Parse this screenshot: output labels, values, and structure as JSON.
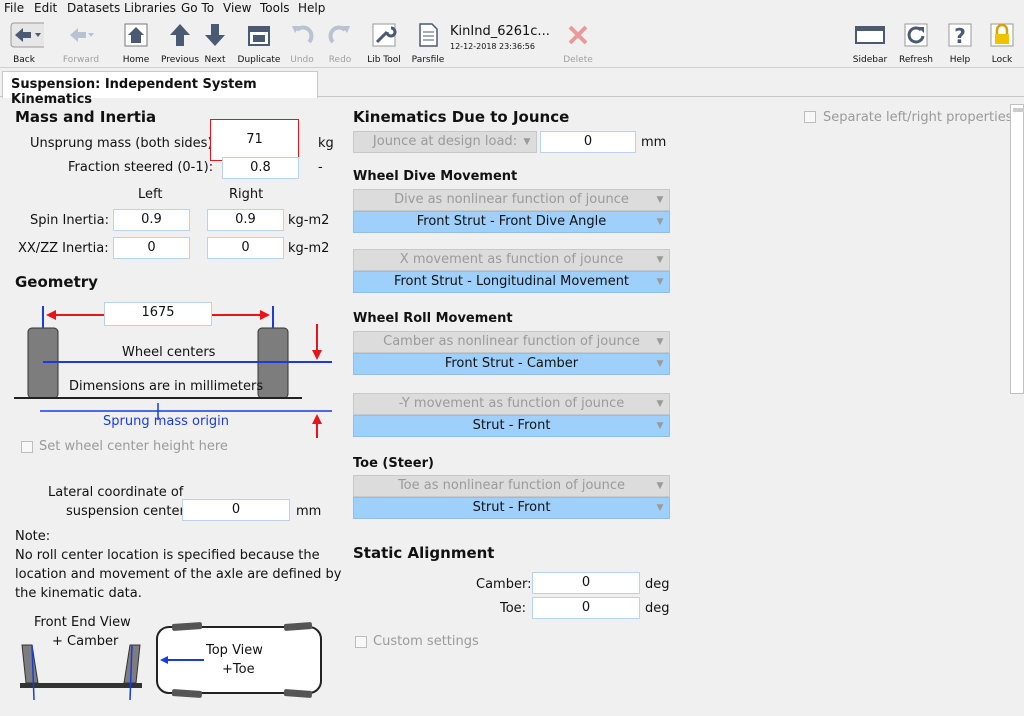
{
  "menu": [
    "File",
    "Edit",
    "Datasets",
    "Libraries",
    "Go To",
    "View",
    "Tools",
    "Help"
  ],
  "toolbar": {
    "back": "Back",
    "forward": "Forward",
    "home": "Home",
    "previous": "Previous",
    "next": "Next",
    "duplicate": "Duplicate",
    "undo": "Undo",
    "redo": "Redo",
    "libtool": "Lib Tool",
    "parsfile": "Parsfile",
    "dataset_title": "KinInd_6261c...",
    "dataset_date": "12-12-2018 23:36:56",
    "delete": "Delete",
    "sidebar": "Sidebar",
    "refresh": "Refresh",
    "help": "Help",
    "lock": "Lock"
  },
  "tab_title": "Suspension: Independent System Kinematics",
  "mass": {
    "heading": "Mass and Inertia",
    "unsprung_label": "Unsprung mass (both sides):",
    "unsprung_value": "71",
    "unsprung_unit": "kg",
    "fraction_label": "Fraction steered (0-1):",
    "fraction_value": "0.8",
    "fraction_unit": "-",
    "left": "Left",
    "right": "Right",
    "spin_label": "Spin Inertia:",
    "spin_left": "0.9",
    "spin_right": "0.9",
    "spin_unit": "kg-m2",
    "xxzz_label": "XX/ZZ Inertia:",
    "xxzz_left": "0",
    "xxzz_right": "0",
    "xxzz_unit": "kg-m2"
  },
  "geometry": {
    "heading": "Geometry",
    "track": "1675",
    "wheel_centers": "Wheel centers",
    "dims_note": "Dimensions are in millimeters",
    "sprung_origin": "Sprung mass origin",
    "set_height": "Set wheel center height here",
    "lateral_label1": "Lateral coordinate of",
    "lateral_label2": "suspension center:",
    "lateral_value": "0",
    "lateral_unit": "mm",
    "note_title": "Note:",
    "note_lines": [
      "No roll center location is specified because the",
      "location and movement of the axle are defined by",
      "the kinematic data."
    ],
    "front_view1": "Front End View",
    "front_view2": "+ Camber",
    "top_view1": "Top View",
    "top_view2": "+Toe"
  },
  "kinematics": {
    "heading": "Kinematics Due to Jounce",
    "jounce_label": "Jounce at design load:",
    "jounce_value": "0",
    "jounce_unit": "mm",
    "separate": "Separate left/right properties",
    "dive_heading": "Wheel Dive Movement",
    "dive_func": "Dive as nonlinear function of jounce",
    "dive_dataset": "Front Strut - Front Dive Angle",
    "x_func": "X movement as function of jounce",
    "x_dataset": "Front Strut -  Longitudinal Movement",
    "roll_heading": "Wheel Roll Movement",
    "camber_func": "Camber as nonlinear function of jounce",
    "camber_dataset": "Front Strut - Camber",
    "y_func": "-Y movement as function of jounce",
    "y_dataset": "Strut - Front",
    "toe_heading": "Toe (Steer)",
    "toe_func": "Toe as nonlinear function of jounce",
    "toe_dataset": "Strut - Front"
  },
  "static": {
    "heading": "Static Alignment",
    "camber_label": "Camber:",
    "camber_value": "0",
    "camber_unit": "deg",
    "toe_label": "Toe:",
    "toe_value": "0",
    "toe_unit": "deg",
    "custom": "Custom settings"
  },
  "colors": {
    "accent_blue": "#9fd0fb",
    "highlight_red": "#e8141a",
    "line_blue": "#1a3cdc"
  }
}
